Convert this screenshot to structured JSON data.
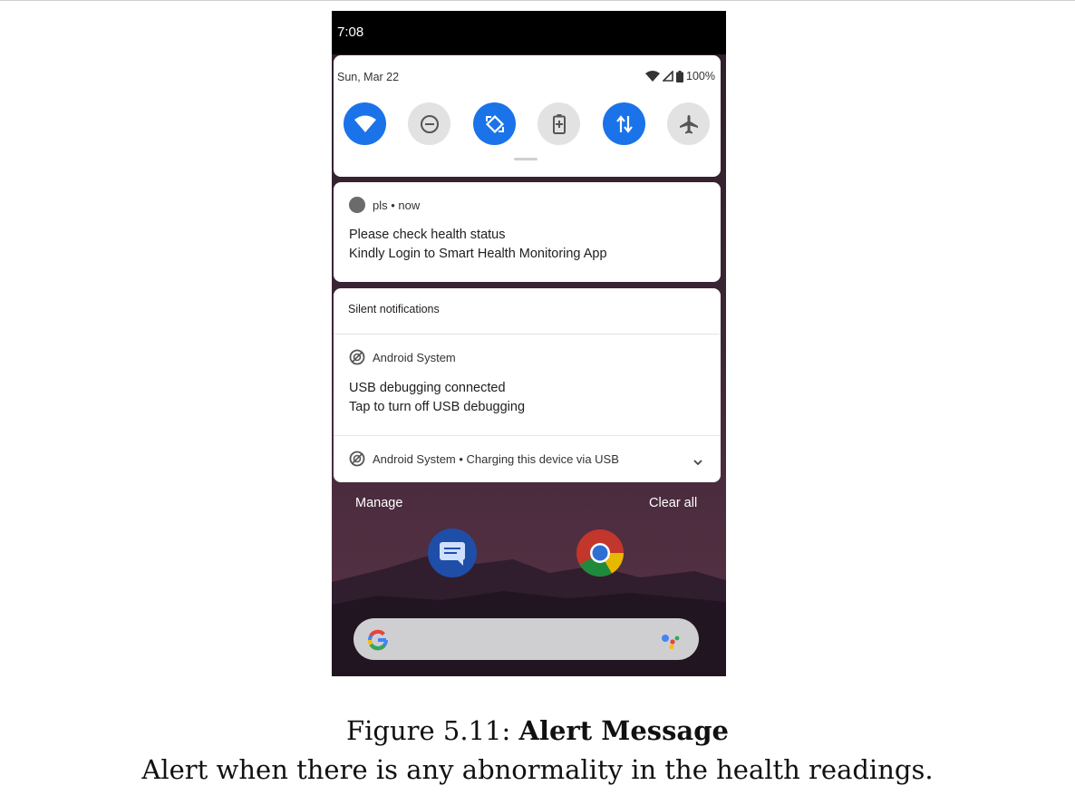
{
  "status_bar": {
    "time": "7:08"
  },
  "quick_settings": {
    "date": "Sun, Mar 22",
    "battery": "100%",
    "tiles": [
      {
        "name": "wifi",
        "state": "on",
        "icon": "wifi-icon"
      },
      {
        "name": "do-not-disturb",
        "state": "off",
        "icon": "minus-circle-icon"
      },
      {
        "name": "auto-rotate",
        "state": "on",
        "icon": "rotate-icon"
      },
      {
        "name": "battery-saver",
        "state": "off",
        "icon": "battery-saver-icon"
      },
      {
        "name": "mobile-data",
        "state": "on",
        "icon": "data-arrows-icon"
      },
      {
        "name": "airplane-mode",
        "state": "off",
        "icon": "airplane-icon"
      }
    ]
  },
  "notification": {
    "app": "pls • now",
    "title": "Please check health status",
    "text": "Kindly Login to Smart Health Monitoring App"
  },
  "silent": {
    "header": "Silent notifications",
    "system": {
      "app": "Android System",
      "title": "USB debugging connected",
      "text": "Tap to turn off USB debugging"
    },
    "collapsed": "Android System • Charging this device via USB"
  },
  "actions": {
    "manage": "Manage",
    "clear_all": "Clear all"
  },
  "colors": {
    "accent": "#1a73e8",
    "tile_off": "#e2e2e2"
  },
  "caption": {
    "prefix": "Figure 5.11: ",
    "title": "Alert Message",
    "subtitle": "Alert when there is any abnormality in the health readings."
  }
}
